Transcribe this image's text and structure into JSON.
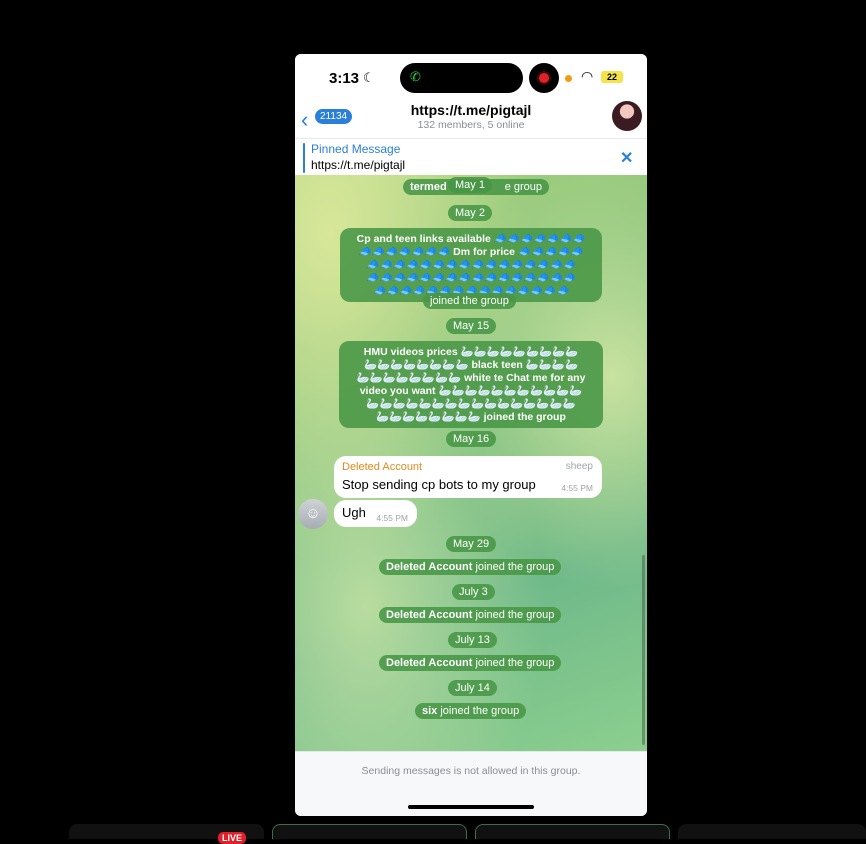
{
  "status_bar": {
    "time": "3:13",
    "battery": "22"
  },
  "header": {
    "back_count": "21134",
    "title": "https://t.me/pigtajl",
    "subtitle": "132 members, 5 online"
  },
  "pinned": {
    "label": "Pinned Message",
    "text": "https://t.me/pigtajl"
  },
  "chat": {
    "date_may1": "May 1",
    "partial_service": "termed",
    "partial_service_tail": "e group",
    "date_may2": "May 2",
    "spam1_lines": [
      "Cp and teen links available 🧢🧢🧢🧢🧢🧢🧢",
      "🧢🧢🧢🧢🧢🧢🧢 Dm for price 🧢🧢🧢🧢🧢",
      "🧢🧢🧢🧢🧢🧢🧢🧢🧢🧢🧢🧢🧢🧢🧢🧢",
      "🧢🧢🧢🧢🧢🧢🧢🧢🧢🧢🧢🧢🧢🧢🧢🧢",
      "🧢🧢🧢🧢🧢🧢🧢🧢🧢🧢🧢🧢🧢🧢🧢"
    ],
    "spam1_tail": "joined the group",
    "date_may15": "May 15",
    "spam2_lines": [
      "HMU videos prices 🦢🦢🦢🦢🦢🦢🦢🦢🦢",
      "🦢🦢🦢🦢🦢🦢🦢🦢 black teen 🦢🦢🦢🦢",
      "🦢🦢🦢🦢🦢🦢🦢🦢 white te Chat me for any",
      "video you want 🦢🦢🦢🦢🦢🦢🦢🦢🦢🦢🦢",
      "🦢🦢🦢🦢🦢🦢🦢🦢🦢🦢🦢🦢🦢🦢🦢🦢",
      "🦢🦢🦢🦢🦢🦢🦢🦢 joined the group"
    ],
    "date_may16": "May 16",
    "msg1": {
      "sender": "Deleted Account",
      "tag": "sheep",
      "text": "Stop sending cp bots to my group",
      "time": "4:55 PM"
    },
    "msg2": {
      "text": "Ugh",
      "time": "4:55 PM"
    },
    "date_may29": "May 29",
    "join1": {
      "name": "Deleted Account",
      "action": "joined the group"
    },
    "date_july3": "July 3",
    "join2": {
      "name": "Deleted Account",
      "action": "joined the group"
    },
    "date_july13": "July 13",
    "join3": {
      "name": "Deleted Account",
      "action": "joined the group"
    },
    "date_july14": "July 14",
    "join4": {
      "name": "six",
      "action": "joined the group"
    }
  },
  "bottom": {
    "notice": "Sending messages is not allowed in this group."
  },
  "dock": {
    "live_badge": "LIVE"
  },
  "colors": {
    "accent": "#2a7fd8",
    "sender": "#e08a1e",
    "service_pill": "#4f9a48"
  },
  "icons": [
    "moon-icon",
    "phone-icon",
    "record-icon",
    "wifi-icon",
    "battery-icon",
    "back-chevron-icon",
    "close-icon",
    "ghost-avatar-icon"
  ]
}
